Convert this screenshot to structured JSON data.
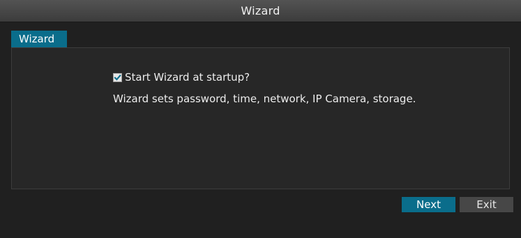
{
  "window": {
    "title": "Wizard"
  },
  "tabs": [
    {
      "label": "Wizard",
      "active": true
    }
  ],
  "content": {
    "startup_checkbox": {
      "label": "Start Wizard at startup?",
      "checked": true
    },
    "description": "Wizard sets password, time, network, IP Camera, storage."
  },
  "buttons": {
    "next_label": "Next",
    "exit_label": "Exit"
  },
  "colors": {
    "accent": "#0a6d8b",
    "background": "#202020",
    "panel": "#272727",
    "titlebar": "#474747",
    "secondary_button": "#474747"
  },
  "icons": {
    "checkbox": "checkmark-icon"
  }
}
